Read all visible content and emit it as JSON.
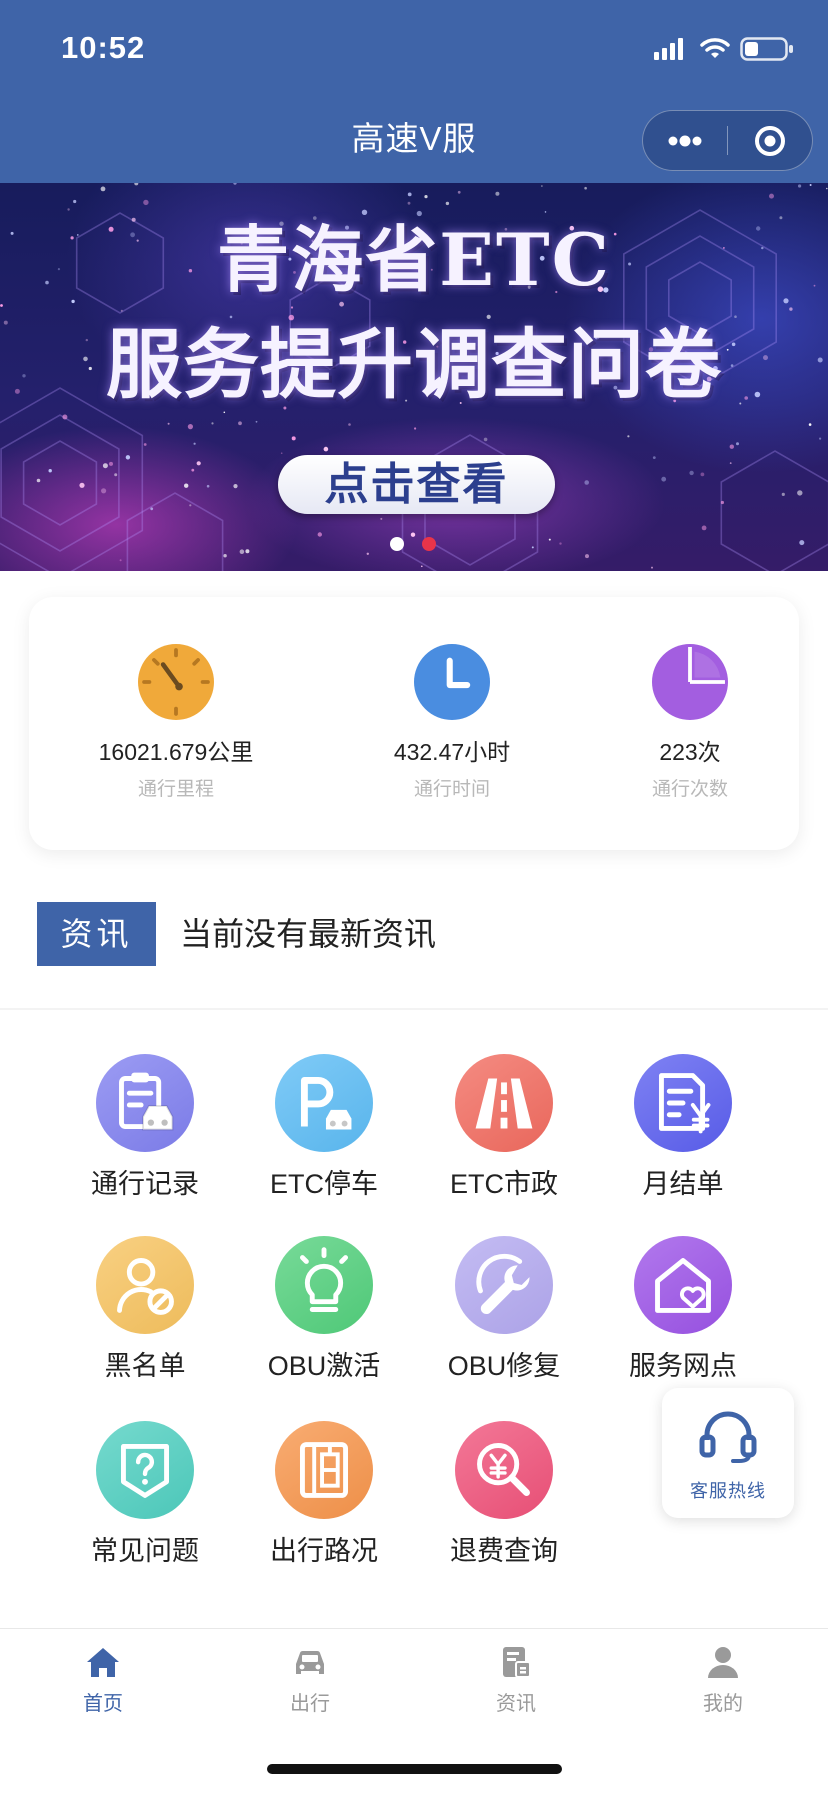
{
  "status_bar": {
    "time": "10:52",
    "icons": [
      "cellular-signal-icon",
      "wifi-icon",
      "battery-icon"
    ]
  },
  "nav": {
    "title": "高速V服",
    "capsule": [
      "more-dots-icon",
      "close-target-icon"
    ]
  },
  "banner": {
    "line1": "青海省ETC",
    "line2": "服务提升调查问卷",
    "button": "点击查看",
    "pager": {
      "count": 2,
      "active": 1
    }
  },
  "stats": [
    {
      "value": "16021.679公里",
      "label": "通行里程",
      "icon": "speedometer-icon",
      "color": "#f0a93a"
    },
    {
      "value": "432.47小时",
      "label": "通行时间",
      "icon": "clock-icon",
      "color": "#4a8de0"
    },
    {
      "value": "223次",
      "label": "通行次数",
      "icon": "pie-chart-icon",
      "color": "#a35ee0"
    }
  ],
  "news": {
    "tag": "资讯",
    "text": "当前没有最新资讯"
  },
  "services": [
    {
      "label": "通行记录",
      "icon": "clipboard-car-icon",
      "color": "#8080f0"
    },
    {
      "label": "ETC停车",
      "icon": "parking-icon",
      "color": "#5cbcf5"
    },
    {
      "label": "ETC市政",
      "icon": "road-icon",
      "color": "#f26b5f"
    },
    {
      "label": "月结单",
      "icon": "bill-yen-icon",
      "color": "#5b5ff0"
    },
    {
      "label": "黑名单",
      "icon": "user-blocked-icon",
      "color": "#f7c35f"
    },
    {
      "label": "OBU激活",
      "icon": "lightbulb-icon",
      "color": "#52d07c"
    },
    {
      "label": "OBU修复",
      "icon": "wrench-icon",
      "color": "#b3a9f0"
    },
    {
      "label": "服务网点",
      "icon": "house-heart-icon",
      "color": "#9c53e8"
    },
    {
      "label": "常见问题",
      "icon": "question-shield-icon",
      "color": "#4fcfc0"
    },
    {
      "label": "出行路况",
      "icon": "road-sign-icon",
      "color": "#f7954b"
    },
    {
      "label": "退费查询",
      "icon": "refund-search-icon",
      "color": "#f0527a"
    }
  ],
  "float_service": {
    "label": "客服热线",
    "icon": "headset-icon"
  },
  "tabbar": [
    {
      "label": "首页",
      "icon": "home-icon",
      "active": true
    },
    {
      "label": "出行",
      "icon": "car-icon",
      "active": false
    },
    {
      "label": "资讯",
      "icon": "news-icon",
      "active": false
    },
    {
      "label": "我的",
      "icon": "user-icon",
      "active": false
    }
  ],
  "colors": {
    "header": "#3f64a8",
    "pager_active": "#e8344a",
    "pager_inactive": "#ffffff",
    "tab_inactive": "#9a9a9a"
  }
}
